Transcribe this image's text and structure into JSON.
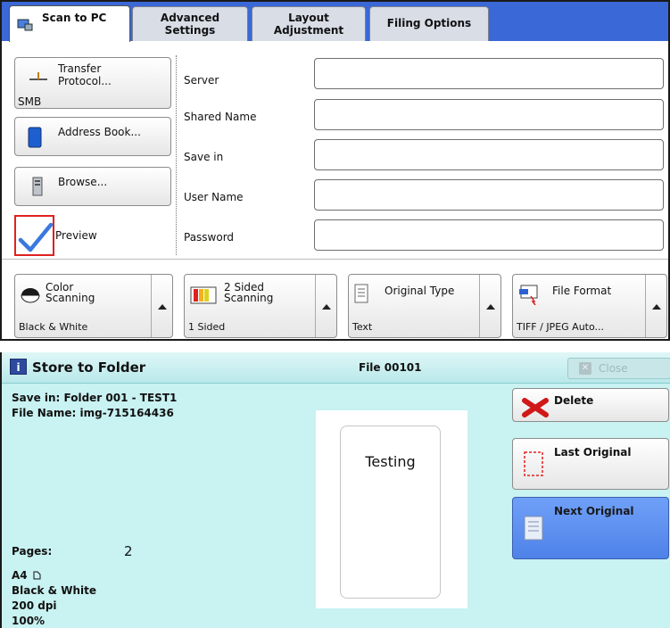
{
  "tabs": [
    {
      "label": "Scan to PC",
      "active": true
    },
    {
      "label": "Advanced Settings",
      "active": false
    },
    {
      "label": "Layout Adjustment",
      "active": false
    },
    {
      "label": "Filing Options",
      "active": false
    }
  ],
  "left_buttons": {
    "transfer_protocol": {
      "label": "Transfer Protocol...",
      "value": "SMB"
    },
    "address_book": {
      "label": "Address Book..."
    },
    "browse": {
      "label": "Browse..."
    },
    "preview": {
      "label": "Preview",
      "checked": true
    }
  },
  "fields": [
    {
      "label": "Server",
      "value": ""
    },
    {
      "label": "Shared Name",
      "value": ""
    },
    {
      "label": "Save in",
      "value": ""
    },
    {
      "label": "User Name",
      "value": ""
    },
    {
      "label": "Password",
      "value": ""
    }
  ],
  "options": [
    {
      "title": "Color Scanning",
      "value": "Black & White",
      "icon": "color-scanning-icon"
    },
    {
      "title": "2 Sided Scanning",
      "value": "1 Sided",
      "icon": "two-sided-icon"
    },
    {
      "title": "Original Type",
      "value": "Text",
      "icon": "document-icon"
    },
    {
      "title": "File Format",
      "value": "TIFF / JPEG Auto...",
      "icon": "file-format-icon"
    }
  ],
  "dialog": {
    "title": "Store to Folder",
    "file": "File 00101",
    "close_label": "Close",
    "save_in": "Save in: Folder 001 - TEST1",
    "file_name": "File Name: img-715164436",
    "pages_label": "Pages:",
    "pages_value": "2",
    "paper": "A4",
    "color_mode": "Black & White",
    "resolution": "200 dpi",
    "scale": "100%",
    "preview_text": "Testing",
    "delete_label": "Delete",
    "last_original_label": "Last Original",
    "next_original_label": "Next Original"
  },
  "colors": {
    "tab_bar": "#3a68d6",
    "dialog_bg": "#c9f2f2",
    "next_original_bg": "#5b8ef0",
    "checkbox": "#3a78e0",
    "highlight_border": "#e02020"
  }
}
